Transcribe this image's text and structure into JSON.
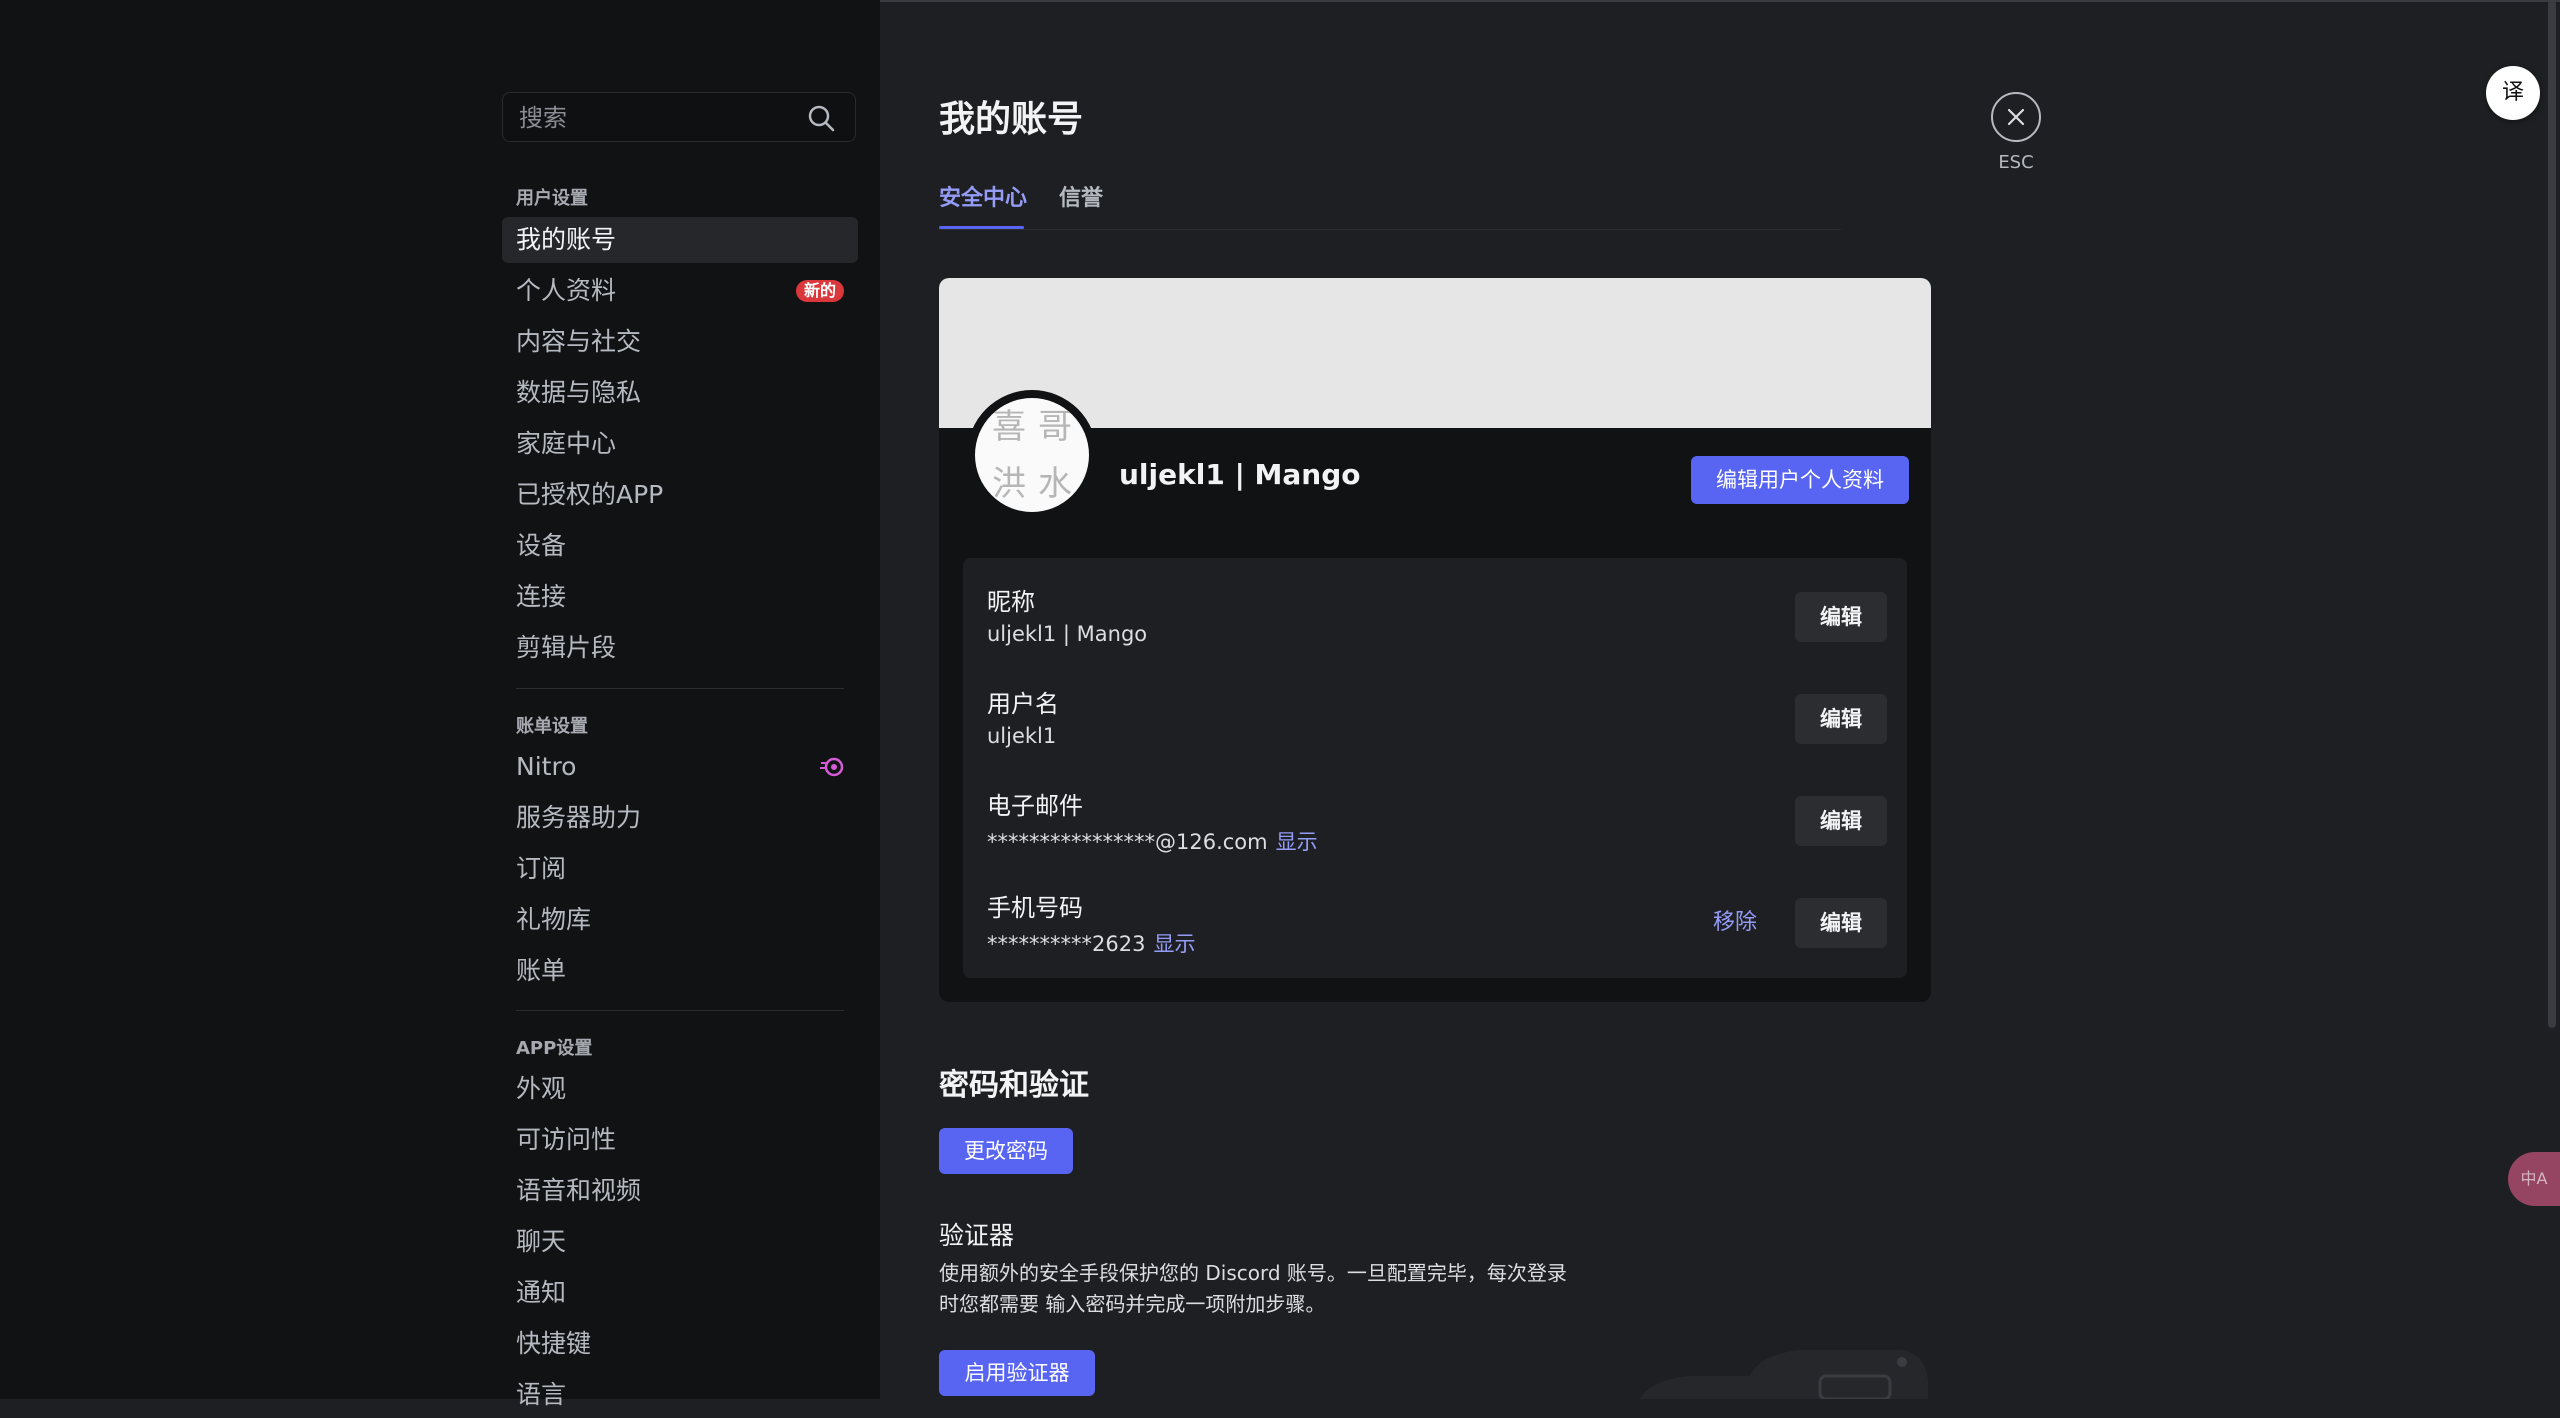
{
  "sidebar": {
    "search_placeholder": "搜索",
    "sections": [
      {
        "title": "用户设置"
      },
      {
        "title": "账单设置"
      },
      {
        "title": "APP设置"
      }
    ],
    "user_items": [
      {
        "label": "我的账号"
      },
      {
        "label": "个人资料",
        "badge": "新的"
      },
      {
        "label": "内容与社交"
      },
      {
        "label": "数据与隐私"
      },
      {
        "label": "家庭中心"
      },
      {
        "label": "已授权的APP"
      },
      {
        "label": "设备"
      },
      {
        "label": "连接"
      },
      {
        "label": "剪辑片段"
      }
    ],
    "billing_items": [
      {
        "label": "Nitro",
        "icon": "nitro-icon"
      },
      {
        "label": "服务器助力"
      },
      {
        "label": "订阅"
      },
      {
        "label": "礼物库"
      },
      {
        "label": "账单"
      }
    ],
    "app_items": [
      {
        "label": "外观"
      },
      {
        "label": "可访问性"
      },
      {
        "label": "语音和视频"
      },
      {
        "label": "聊天"
      },
      {
        "label": "通知"
      },
      {
        "label": "快捷键"
      },
      {
        "label": "语言"
      }
    ]
  },
  "main": {
    "title": "我的账号",
    "tabs": [
      {
        "label": "安全中心",
        "active": true
      },
      {
        "label": "信誉",
        "active": false
      }
    ],
    "close": {
      "esc_label": "ESC"
    },
    "profile": {
      "name": "uljekl1 | Mango",
      "edit_profile_label": "编辑用户个人资料",
      "avatar_chars": [
        "喜",
        "哥",
        "洪",
        "水"
      ],
      "banner_color": "#e6e6e6"
    },
    "fields": [
      {
        "label": "昵称",
        "value": "uljekl1 | Mango",
        "edit_label": "编辑"
      },
      {
        "label": "用户名",
        "value": "uljekl1",
        "edit_label": "编辑"
      },
      {
        "label": "电子邮件",
        "value": "****************@126.com",
        "reveal_label": "显示",
        "edit_label": "编辑"
      },
      {
        "label": "手机号码",
        "value": "**********2623",
        "reveal_label": "显示",
        "remove_label": "移除",
        "edit_label": "编辑"
      }
    ],
    "password_section": {
      "title": "密码和验证",
      "change_password_label": "更改密码",
      "authenticator_title": "验证器",
      "authenticator_desc_line1": "使用额外的安全手段保护您的 Discord 账号。一旦配置完毕，每次登录",
      "authenticator_desc_line2": "时您都需要 输入密码并完成一项附加步骤。",
      "enable_authenticator_label": "启用验证器"
    }
  },
  "overlay": {
    "translate_label": "译",
    "float_tool_label": "中A"
  },
  "colors": {
    "accent": "#5865f2",
    "link": "#949cf7",
    "danger_badge": "#da373c",
    "sidebar_bg": "#111214",
    "main_bg": "#1e1f22"
  }
}
